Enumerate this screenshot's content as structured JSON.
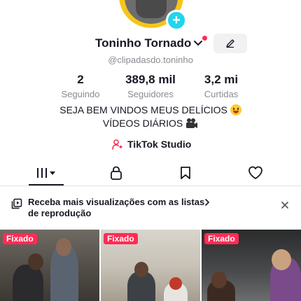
{
  "profile": {
    "username": "Toninho Tornado",
    "handle": "@clipadasdo.toninho",
    "avatar_color": "#f5c518",
    "add_icon": "plus-icon"
  },
  "stats": [
    {
      "value": "2",
      "label": "Seguindo"
    },
    {
      "value": "389,8 mil",
      "label": "Seguidores"
    },
    {
      "value": "3,2 mi",
      "label": "Curtidas"
    }
  ],
  "bio": {
    "line1": "SEJA BEM VINDOS MEUS DELÍCIOS",
    "line2": "VÍDEOS DIÁRIOS"
  },
  "studio": {
    "label": "TikTok Studio"
  },
  "tabs": [
    {
      "name": "videos",
      "icon": "grid-bars-icon"
    },
    {
      "name": "private",
      "icon": "lock-icon"
    },
    {
      "name": "favorites",
      "icon": "bookmark-icon"
    },
    {
      "name": "liked",
      "icon": "heart-icon"
    }
  ],
  "banner": {
    "text": "Receba mais visualizações com as listas de reprodução"
  },
  "videos": [
    {
      "badge": "Fixado"
    },
    {
      "badge": "Fixado"
    },
    {
      "badge": "Fixado"
    }
  ],
  "colors": {
    "accent": "#fe2c55",
    "add_button": "#20d5ec",
    "muted": "#8a8b91",
    "text": "#161823"
  }
}
